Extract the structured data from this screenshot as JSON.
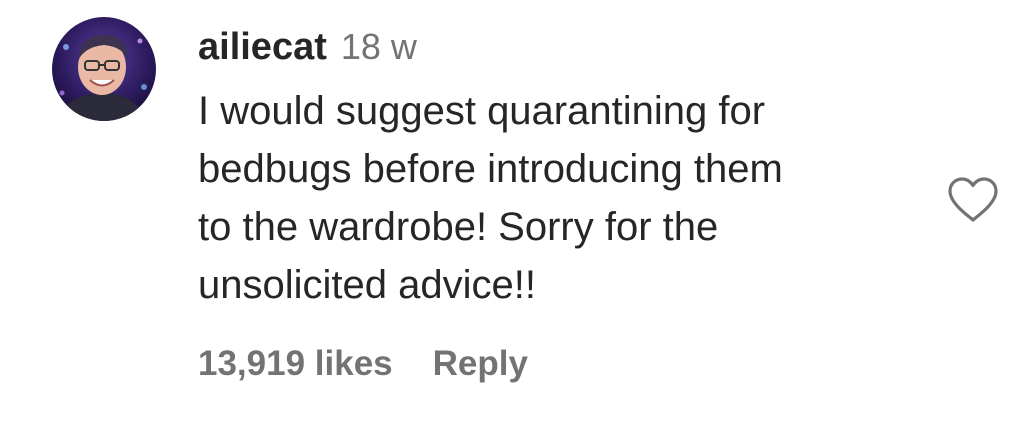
{
  "comment": {
    "username": "ailiecat",
    "timestamp": "18 w",
    "text_lines": [
      "I would suggest quarantining for",
      "bedbugs before introducing them",
      "to the wardrobe! Sorry for the",
      "unsolicited advice!!"
    ],
    "likes_label": "13,919 likes",
    "reply_label": "Reply",
    "like_icon": "heart-outline-icon",
    "avatar_icon": "user-avatar"
  }
}
